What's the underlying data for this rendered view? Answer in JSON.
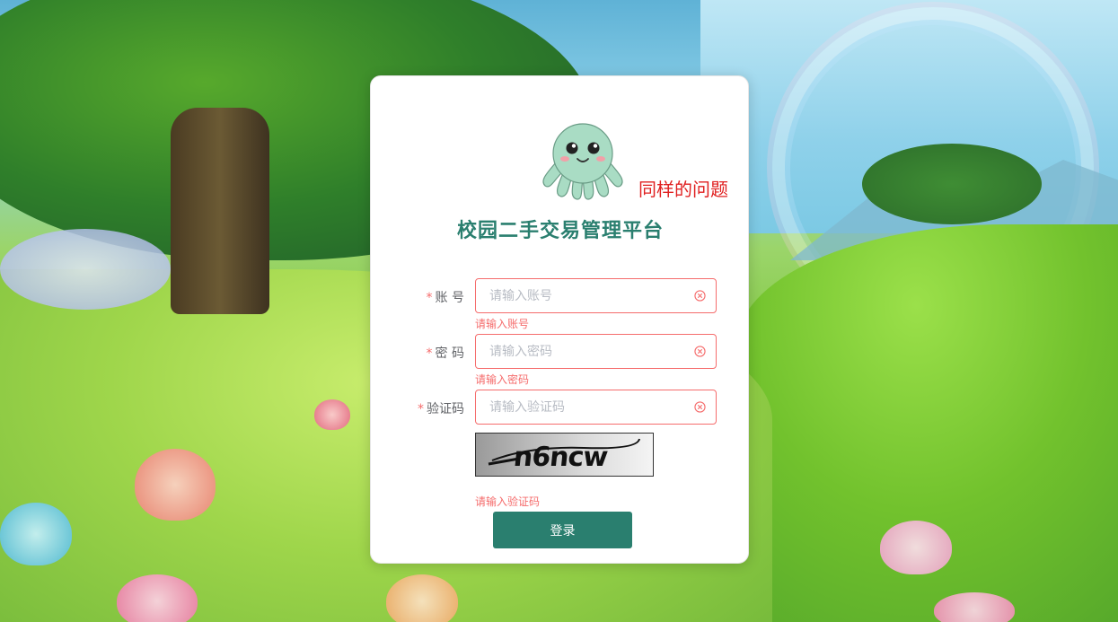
{
  "annotation": "同样的问题",
  "title": "校园二手交易管理平台",
  "form": {
    "account": {
      "required_mark": "*",
      "label": "账 号",
      "placeholder": "请输入账号",
      "value": "",
      "error": "请输入账号"
    },
    "password": {
      "required_mark": "*",
      "label": "密 码",
      "placeholder": "请输入密码",
      "value": "",
      "error": "请输入密码"
    },
    "captcha": {
      "required_mark": "*",
      "label": "验证码",
      "placeholder": "请输入验证码",
      "value": "",
      "image_text": "n6ncw",
      "error": "请输入验证码"
    },
    "submit_label": "登录"
  },
  "icons": {
    "clear": "circle-close-icon",
    "mascot": "octopus-mascot-icon"
  },
  "colors": {
    "primary": "#2a7f6f",
    "error": "#f56c6c",
    "annotation": "#e02020"
  }
}
